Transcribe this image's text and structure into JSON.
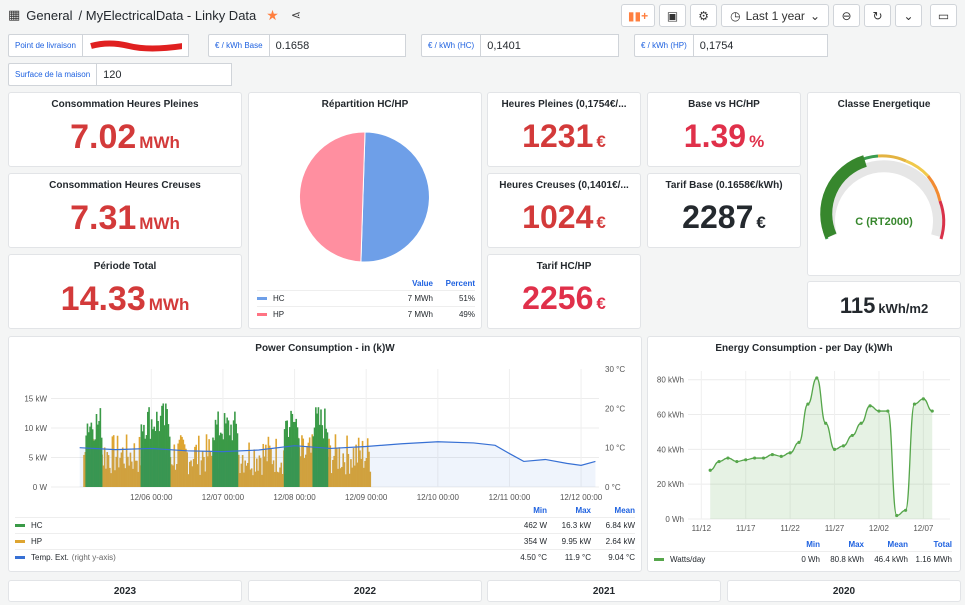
{
  "header": {
    "folder": "General",
    "title": "/ MyElectricalData - Linky Data",
    "time_range": "Last 1 year"
  },
  "variables": [
    {
      "label": "Point de livraison",
      "value": "25XXXXXXXXXXXX"
    },
    {
      "label": "€ / kWh Base",
      "value": "0.1658"
    },
    {
      "label": "€ / kWh (HC)",
      "value": "0,1401"
    },
    {
      "label": "€ / kWh (HP)",
      "value": "0,1754"
    },
    {
      "label": "Surface de la maison",
      "value": "120"
    }
  ],
  "stats": {
    "conso_hp": {
      "title": "Consommation Heures Pleines",
      "value": "7.02",
      "unit": "MWh"
    },
    "conso_hc": {
      "title": "Consommation Heures Creuses",
      "value": "7.31",
      "unit": "MWh"
    },
    "periode_total": {
      "title": "Période Total",
      "value": "14.33",
      "unit": "MWh"
    },
    "heures_pleines": {
      "title": "Heures Pleines (0,1754€/...",
      "value": "1231",
      "unit": "€"
    },
    "heures_creuses": {
      "title": "Heures Creuses (0,1401€/...",
      "value": "1024",
      "unit": "€"
    },
    "tarif_hchp": {
      "title": "Tarif HC/HP",
      "value": "2256",
      "unit": "€"
    },
    "base_vs": {
      "title": "Base vs HC/HP",
      "value": "1.39",
      "unit": "%"
    },
    "tarif_base": {
      "title": "Tarif Base (0.1658€/kWh)",
      "value": "2287",
      "unit": "€"
    },
    "classe": {
      "title": "Classe Energetique",
      "value": "C (RT2000)"
    },
    "surface_conso": {
      "value": "115",
      "unit": "kWh/m2"
    }
  },
  "pie": {
    "title": "Répartition HC/HP",
    "col_value": "Value",
    "col_percent": "Percent",
    "rows": [
      {
        "name": "HC",
        "value": "7 MWh",
        "percent": "51%",
        "color": "#6e9fe8"
      },
      {
        "name": "HP",
        "value": "7 MWh",
        "percent": "49%",
        "color": "#ff7383"
      }
    ]
  },
  "power_chart": {
    "title": "Power Consumption - in (k)W",
    "legend_head": [
      "Min",
      "Max",
      "Mean"
    ],
    "legend": [
      {
        "name": "HC",
        "min": "462 W",
        "max": "16.3 kW",
        "mean": "6.84 kW",
        "color": "#3a9a47"
      },
      {
        "name": "HP",
        "min": "354 W",
        "max": "9.95 kW",
        "mean": "2.64 kW",
        "color": "#dea531"
      },
      {
        "name": "Temp. Ext.",
        "note": "(right y-axis)",
        "min": "4.50 °C",
        "max": "11.9 °C",
        "mean": "9.04 °C",
        "color": "#3770d4"
      }
    ]
  },
  "energy_chart": {
    "title": "Energy Consumption - per Day (k)Wh",
    "legend_head": [
      "Min",
      "Max",
      "Mean",
      "Total"
    ],
    "legend": [
      {
        "name": "Watts/day",
        "min": "0 Wh",
        "max": "80.8 kWh",
        "mean": "46.4 kWh",
        "total": "1.16 MWh",
        "color": "#56a64b"
      }
    ]
  },
  "year_panels": [
    "2023",
    "2022",
    "2021",
    "2020"
  ],
  "chart_data": [
    {
      "type": "bar",
      "title": "Power Consumption - in (k)W",
      "x_ticks": [
        "12/06 00:00",
        "12/07 00:00",
        "12/08 00:00",
        "12/09 00:00",
        "12/10 00:00",
        "12/11 00:00",
        "12/12 00:00"
      ],
      "y_ticks_left": [
        "0 W",
        "5 kW",
        "10 kW",
        "15 kW"
      ],
      "y_ticks_right": [
        "0 °C",
        "10 °C",
        "20 °C",
        "30 °C"
      ],
      "ylim_left": [
        0,
        20
      ],
      "ylim_right": [
        0,
        30
      ],
      "hc_blocks": [
        {
          "start": 5.08,
          "end": 5.3,
          "level": 14
        },
        {
          "start": 5.85,
          "end": 6.25,
          "level": 14.5
        },
        {
          "start": 6.85,
          "end": 7.2,
          "level": 13
        },
        {
          "start": 7.85,
          "end": 8.05,
          "level": 14
        },
        {
          "start": 8.25,
          "end": 8.45,
          "level": 14
        }
      ],
      "series": [
        {
          "name": "HC",
          "color": "#3a9a47"
        },
        {
          "name": "HP",
          "color": "#dea531"
        },
        {
          "name": "Temp. Ext.",
          "color": "#3770d4"
        }
      ],
      "temperature": [
        [
          5.0,
          10
        ],
        [
          5.5,
          9.5
        ],
        [
          6.0,
          9.8
        ],
        [
          6.5,
          9.2
        ],
        [
          7.0,
          9.0
        ],
        [
          7.5,
          9.4
        ],
        [
          8.0,
          10.5
        ],
        [
          8.5,
          9.8
        ],
        [
          9.0,
          10.3
        ],
        [
          9.5,
          11.0
        ],
        [
          10.0,
          11.5
        ],
        [
          10.5,
          11.2
        ],
        [
          10.8,
          10.6
        ],
        [
          11.0,
          8.5
        ],
        [
          11.2,
          6.5
        ],
        [
          11.5,
          7.0
        ],
        [
          11.8,
          6.0
        ],
        [
          12.0,
          5.5
        ],
        [
          12.2,
          6.5
        ]
      ]
    },
    {
      "type": "area",
      "title": "Energy Consumption - per Day (k)Wh",
      "x_ticks": [
        "11/12",
        "11/17",
        "11/22",
        "11/27",
        "12/02",
        "12/07"
      ],
      "y_ticks": [
        "0 Wh",
        "20 kWh",
        "40 kWh",
        "60 kWh",
        "80 kWh"
      ],
      "ylim": [
        0,
        85
      ],
      "series": [
        {
          "name": "Watts/day",
          "color": "#56a64b",
          "x": [
            13,
            14,
            15,
            16,
            17,
            18,
            19,
            20,
            21,
            22,
            23,
            24,
            25,
            26,
            27,
            28,
            29,
            30,
            31,
            32,
            33,
            34,
            35,
            36,
            37,
            38
          ],
          "values": [
            28,
            33,
            35,
            33,
            34,
            35,
            35,
            37,
            36,
            38,
            44,
            66,
            81,
            55,
            40,
            42,
            48,
            55,
            65,
            62,
            62,
            2,
            5,
            66,
            69,
            62
          ]
        }
      ]
    }
  ]
}
